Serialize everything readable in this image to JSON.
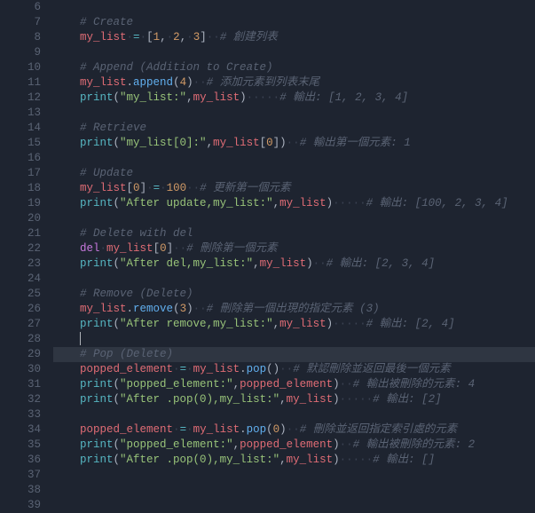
{
  "gutter": {
    "start": 6,
    "end": 39
  },
  "current_line": 29,
  "lines": [
    {
      "n": 6,
      "tokens": []
    },
    {
      "n": 7,
      "tokens": [
        [
          "comment",
          "# Create"
        ]
      ]
    },
    {
      "n": 8,
      "tokens": [
        [
          "ident",
          "my_list"
        ],
        [
          "ws",
          "·"
        ],
        [
          "op",
          "="
        ],
        [
          "ws",
          "·"
        ],
        [
          "punct",
          "["
        ],
        [
          "number",
          "1"
        ],
        [
          "punct",
          ","
        ],
        [
          "ws",
          "·"
        ],
        [
          "number",
          "2"
        ],
        [
          "punct",
          ","
        ],
        [
          "ws",
          "·"
        ],
        [
          "number",
          "3"
        ],
        [
          "punct",
          "]"
        ],
        [
          "ws",
          "··"
        ],
        [
          "comment",
          "# 創建列表"
        ]
      ]
    },
    {
      "n": 9,
      "tokens": []
    },
    {
      "n": 10,
      "tokens": [
        [
          "comment",
          "# Append (Addition to Create)"
        ]
      ]
    },
    {
      "n": 11,
      "tokens": [
        [
          "ident",
          "my_list"
        ],
        [
          "punct",
          "."
        ],
        [
          "func",
          "append"
        ],
        [
          "punct",
          "("
        ],
        [
          "number",
          "4"
        ],
        [
          "punct",
          ")"
        ],
        [
          "ws",
          "··"
        ],
        [
          "comment",
          "# 添加元素到列表末尾"
        ]
      ]
    },
    {
      "n": 12,
      "tokens": [
        [
          "builtin",
          "print"
        ],
        [
          "punct",
          "("
        ],
        [
          "string",
          "\"my_list:\""
        ],
        [
          "punct",
          ","
        ],
        [
          "ident",
          "my_list"
        ],
        [
          "punct",
          ")"
        ],
        [
          "ws",
          "·····"
        ],
        [
          "comment",
          "# 輸出: [1, 2, 3, 4]"
        ]
      ]
    },
    {
      "n": 13,
      "tokens": []
    },
    {
      "n": 14,
      "tokens": [
        [
          "comment",
          "# Retrieve"
        ]
      ]
    },
    {
      "n": 15,
      "tokens": [
        [
          "builtin",
          "print"
        ],
        [
          "punct",
          "("
        ],
        [
          "string",
          "\"my_list[0]:\""
        ],
        [
          "punct",
          ","
        ],
        [
          "ident",
          "my_list"
        ],
        [
          "punct",
          "["
        ],
        [
          "number",
          "0"
        ],
        [
          "punct",
          "]"
        ],
        [
          "punct",
          ")"
        ],
        [
          "ws",
          "··"
        ],
        [
          "comment",
          "# 輸出第一個元素: 1"
        ]
      ]
    },
    {
      "n": 16,
      "tokens": []
    },
    {
      "n": 17,
      "tokens": [
        [
          "comment",
          "# Update"
        ]
      ]
    },
    {
      "n": 18,
      "tokens": [
        [
          "ident",
          "my_list"
        ],
        [
          "punct",
          "["
        ],
        [
          "number",
          "0"
        ],
        [
          "punct",
          "]"
        ],
        [
          "ws",
          "·"
        ],
        [
          "op",
          "="
        ],
        [
          "ws",
          "·"
        ],
        [
          "number",
          "100"
        ],
        [
          "ws",
          "··"
        ],
        [
          "comment",
          "# 更新第一個元素"
        ]
      ]
    },
    {
      "n": 19,
      "tokens": [
        [
          "builtin",
          "print"
        ],
        [
          "punct",
          "("
        ],
        [
          "string",
          "\"After update,my_list:\""
        ],
        [
          "punct",
          ","
        ],
        [
          "ident",
          "my_list"
        ],
        [
          "punct",
          ")"
        ],
        [
          "ws",
          "·····"
        ],
        [
          "comment",
          "# 輸出: [100, 2, 3, 4]"
        ]
      ]
    },
    {
      "n": 20,
      "tokens": []
    },
    {
      "n": 21,
      "tokens": [
        [
          "comment",
          "# Delete with del"
        ]
      ]
    },
    {
      "n": 22,
      "tokens": [
        [
          "keyword",
          "del"
        ],
        [
          "ws",
          "·"
        ],
        [
          "ident",
          "my_list"
        ],
        [
          "punct",
          "["
        ],
        [
          "number",
          "0"
        ],
        [
          "punct",
          "]"
        ],
        [
          "ws",
          "··"
        ],
        [
          "comment",
          "# 刪除第一個元素"
        ]
      ]
    },
    {
      "n": 23,
      "tokens": [
        [
          "builtin",
          "print"
        ],
        [
          "punct",
          "("
        ],
        [
          "string",
          "\"After del,my_list:\""
        ],
        [
          "punct",
          ","
        ],
        [
          "ident",
          "my_list"
        ],
        [
          "punct",
          ")"
        ],
        [
          "ws",
          "··"
        ],
        [
          "comment",
          "# 輸出: [2, 3, 4]"
        ]
      ]
    },
    {
      "n": 24,
      "tokens": []
    },
    {
      "n": 25,
      "tokens": [
        [
          "comment",
          "# Remove (Delete)"
        ]
      ]
    },
    {
      "n": 26,
      "tokens": [
        [
          "ident",
          "my_list"
        ],
        [
          "punct",
          "."
        ],
        [
          "func",
          "remove"
        ],
        [
          "punct",
          "("
        ],
        [
          "number",
          "3"
        ],
        [
          "punct",
          ")"
        ],
        [
          "ws",
          "··"
        ],
        [
          "comment",
          "# 刪除第一個出現的指定元素 (3)"
        ]
      ]
    },
    {
      "n": 27,
      "tokens": [
        [
          "builtin",
          "print"
        ],
        [
          "punct",
          "("
        ],
        [
          "string",
          "\"After remove,my_list:\""
        ],
        [
          "punct",
          ","
        ],
        [
          "ident",
          "my_list"
        ],
        [
          "punct",
          ")"
        ],
        [
          "ws",
          "·····"
        ],
        [
          "comment",
          "# 輸出: [2, 4]"
        ]
      ]
    },
    {
      "n": 28,
      "tokens": [
        [
          "cursor",
          ""
        ]
      ]
    },
    {
      "n": 29,
      "tokens": [
        [
          "comment",
          "# Pop (Delete)"
        ]
      ]
    },
    {
      "n": 30,
      "tokens": [
        [
          "ident",
          "popped_element"
        ],
        [
          "ws",
          "·"
        ],
        [
          "op",
          "="
        ],
        [
          "ws",
          "·"
        ],
        [
          "ident",
          "my_list"
        ],
        [
          "punct",
          "."
        ],
        [
          "func",
          "pop"
        ],
        [
          "punct",
          "("
        ],
        [
          "punct",
          ")"
        ],
        [
          "ws",
          "··"
        ],
        [
          "comment",
          "# 默認刪除並返回最後一個元素"
        ]
      ]
    },
    {
      "n": 31,
      "tokens": [
        [
          "builtin",
          "print"
        ],
        [
          "punct",
          "("
        ],
        [
          "string",
          "\"popped_element:\""
        ],
        [
          "punct",
          ","
        ],
        [
          "ident",
          "popped_element"
        ],
        [
          "punct",
          ")"
        ],
        [
          "ws",
          "··"
        ],
        [
          "comment",
          "# 輸出被刪除的元素: 4"
        ]
      ]
    },
    {
      "n": 32,
      "tokens": [
        [
          "builtin",
          "print"
        ],
        [
          "punct",
          "("
        ],
        [
          "string",
          "\"After .pop(0),my_list:\""
        ],
        [
          "punct",
          ","
        ],
        [
          "ident",
          "my_list"
        ],
        [
          "punct",
          ")"
        ],
        [
          "ws",
          "·····"
        ],
        [
          "comment",
          "# 輸出: [2]"
        ]
      ]
    },
    {
      "n": 33,
      "tokens": []
    },
    {
      "n": 34,
      "tokens": [
        [
          "ident",
          "popped_element"
        ],
        [
          "ws",
          "·"
        ],
        [
          "op",
          "="
        ],
        [
          "ws",
          "·"
        ],
        [
          "ident",
          "my_list"
        ],
        [
          "punct",
          "."
        ],
        [
          "func",
          "pop"
        ],
        [
          "punct",
          "("
        ],
        [
          "number",
          "0"
        ],
        [
          "punct",
          ")"
        ],
        [
          "ws",
          "··"
        ],
        [
          "comment",
          "# 刪除並返回指定索引處的元素"
        ]
      ]
    },
    {
      "n": 35,
      "tokens": [
        [
          "builtin",
          "print"
        ],
        [
          "punct",
          "("
        ],
        [
          "string",
          "\"popped_element:\""
        ],
        [
          "punct",
          ","
        ],
        [
          "ident",
          "popped_element"
        ],
        [
          "punct",
          ")"
        ],
        [
          "ws",
          "··"
        ],
        [
          "comment",
          "# 輸出被刪除的元素: 2"
        ]
      ]
    },
    {
      "n": 36,
      "tokens": [
        [
          "builtin",
          "print"
        ],
        [
          "punct",
          "("
        ],
        [
          "string",
          "\"After .pop(0),my_list:\""
        ],
        [
          "punct",
          ","
        ],
        [
          "ident",
          "my_list"
        ],
        [
          "punct",
          ")"
        ],
        [
          "ws",
          "·····"
        ],
        [
          "comment",
          "# 輸出: []"
        ]
      ]
    }
  ]
}
